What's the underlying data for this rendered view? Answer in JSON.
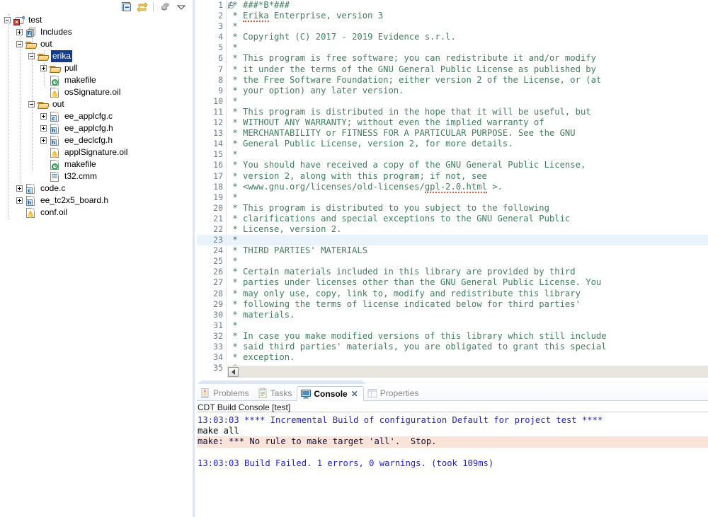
{
  "explorer": {
    "toolbar": [
      {
        "name": "collapse-all-icon",
        "label": "Collapse All"
      },
      {
        "name": "link-with-editor-icon",
        "label": "Link with Editor"
      },
      {
        "name": "view-menu-separator",
        "label": ""
      },
      {
        "name": "build-targets-icon",
        "label": "Build Targets"
      },
      {
        "name": "view-menu-icon",
        "label": "View Menu"
      }
    ],
    "tree": [
      {
        "label": "test",
        "depth": 0,
        "twist": "minus",
        "icon": "c-project-error-icon",
        "selected": false
      },
      {
        "label": "Includes",
        "depth": 1,
        "twist": "plus",
        "icon": "includes-icon",
        "selected": false
      },
      {
        "label": "out",
        "depth": 1,
        "twist": "minus",
        "icon": "folder-icon",
        "selected": false
      },
      {
        "label": "erika",
        "depth": 2,
        "twist": "minus",
        "icon": "folder-icon",
        "selected": true
      },
      {
        "label": "pull",
        "depth": 3,
        "twist": "plus",
        "icon": "folder-icon",
        "selected": false
      },
      {
        "label": "makefile",
        "depth": 3,
        "twist": "none",
        "icon": "makefile-icon",
        "selected": false
      },
      {
        "label": "osSignature.oil",
        "depth": 3,
        "twist": "none",
        "icon": "oil-file-icon",
        "selected": false
      },
      {
        "label": "out",
        "depth": 2,
        "twist": "minus",
        "icon": "folder-icon",
        "selected": false
      },
      {
        "label": "ee_applcfg.c",
        "depth": 3,
        "twist": "plus",
        "icon": "c-source-icon",
        "selected": false
      },
      {
        "label": "ee_applcfg.h",
        "depth": 3,
        "twist": "plus",
        "icon": "h-header-icon",
        "selected": false
      },
      {
        "label": "ee_declcfg.h",
        "depth": 3,
        "twist": "plus",
        "icon": "h-header-icon",
        "selected": false
      },
      {
        "label": "applSignature.oil",
        "depth": 3,
        "twist": "none",
        "icon": "oil-file-icon",
        "selected": false
      },
      {
        "label": "makefile",
        "depth": 3,
        "twist": "none",
        "icon": "makefile-icon",
        "selected": false
      },
      {
        "label": "t32.cmm",
        "depth": 3,
        "twist": "none",
        "icon": "text-file-icon",
        "selected": false
      },
      {
        "label": "code.c",
        "depth": 1,
        "twist": "plus",
        "icon": "c-source-icon",
        "selected": false
      },
      {
        "label": "ee_tc2x5_board.h",
        "depth": 1,
        "twist": "plus",
        "icon": "h-header-icon",
        "selected": false
      },
      {
        "label": "conf.oil",
        "depth": 1,
        "twist": "none",
        "icon": "oil-file-icon",
        "selected": false
      }
    ]
  },
  "editor": {
    "first_line_fold": "collapse-marker",
    "current_line": 23,
    "lines": [
      {
        "n": 1,
        "text": "/* ###*B*###"
      },
      {
        "n": 2,
        "text": " * Erika Enterprise, version 3",
        "squiggle": "Erika"
      },
      {
        "n": 3,
        "text": " *"
      },
      {
        "n": 4,
        "text": " * Copyright (C) 2017 - 2019 Evidence s.r.l."
      },
      {
        "n": 5,
        "text": " *"
      },
      {
        "n": 6,
        "text": " * This program is free software; you can redistribute it and/or modify"
      },
      {
        "n": 7,
        "text": " * it under the terms of the GNU General Public License as published by"
      },
      {
        "n": 8,
        "text": " * the Free Software Foundation; either version 2 of the License, or (at"
      },
      {
        "n": 9,
        "text": " * your option) any later version."
      },
      {
        "n": 10,
        "text": " *"
      },
      {
        "n": 11,
        "text": " * This program is distributed in the hope that it will be useful, but"
      },
      {
        "n": 12,
        "text": " * WITHOUT ANY WARRANTY; without even the implied warranty of"
      },
      {
        "n": 13,
        "text": " * MERCHANTABILITY or FITNESS FOR A PARTICULAR PURPOSE. See the GNU"
      },
      {
        "n": 14,
        "text": " * General Public License, version 2, for more details."
      },
      {
        "n": 15,
        "text": " *"
      },
      {
        "n": 16,
        "text": " * You should have received a copy of the GNU General Public License,"
      },
      {
        "n": 17,
        "text": " * version 2, along with this program; if not, see"
      },
      {
        "n": 18,
        "text": " * <www.gnu.org/licenses/old-licenses/gpl-2.0.html >.",
        "squiggle": "gpl-2.0.html"
      },
      {
        "n": 19,
        "text": " *"
      },
      {
        "n": 20,
        "text": " * This program is distributed to you subject to the following"
      },
      {
        "n": 21,
        "text": " * clarifications and special exceptions to the GNU General Public"
      },
      {
        "n": 22,
        "text": " * License, version 2."
      },
      {
        "n": 23,
        "text": " *"
      },
      {
        "n": 24,
        "text": " * THIRD PARTIES' MATERIALS"
      },
      {
        "n": 25,
        "text": " *"
      },
      {
        "n": 26,
        "text": " * Certain materials included in this library are provided by third"
      },
      {
        "n": 27,
        "text": " * parties under licenses other than the GNU General Public License. You"
      },
      {
        "n": 28,
        "text": " * may only use, copy, link to, modify and redistribute this library"
      },
      {
        "n": 29,
        "text": " * following the terms of license indicated below for third parties'"
      },
      {
        "n": 30,
        "text": " * materials."
      },
      {
        "n": 31,
        "text": " *"
      },
      {
        "n": 32,
        "text": " * In case you make modified versions of this library which still include"
      },
      {
        "n": 33,
        "text": " * said third parties' materials, you are obligated to grant this special"
      },
      {
        "n": 34,
        "text": " * exception."
      },
      {
        "n": 35,
        "text": " *"
      }
    ]
  },
  "console_view": {
    "tabs": [
      {
        "label": "Problems",
        "icon": "problems-icon",
        "active": false,
        "closable": false
      },
      {
        "label": "Tasks",
        "icon": "tasks-icon",
        "active": false,
        "closable": false
      },
      {
        "label": "Console",
        "icon": "console-icon",
        "active": true,
        "closable": true
      },
      {
        "label": "Properties",
        "icon": "properties-icon",
        "active": false,
        "closable": false
      }
    ],
    "close_glyph": "✕",
    "title": "CDT Build Console [test]",
    "output": [
      {
        "text": "13:03:03 **** Incremental Build of configuration Default for project test ****",
        "style": "info"
      },
      {
        "text": "make all",
        "style": "plain"
      },
      {
        "text": "make: *** No rule to make target 'all'.  Stop.",
        "style": "err"
      },
      {
        "text": "",
        "style": "plain"
      },
      {
        "text": "13:03:03 Build Failed. 1 errors, 0 warnings. (took 109ms)",
        "style": "info"
      }
    ]
  },
  "colors": {
    "selection": "#123b8c",
    "comment_text": "#3f7f5f",
    "console_info": "#2323c8",
    "console_error_bg": "#fbe3da",
    "current_line_bg": "#eaf2fb",
    "folder": "#f7c458"
  }
}
